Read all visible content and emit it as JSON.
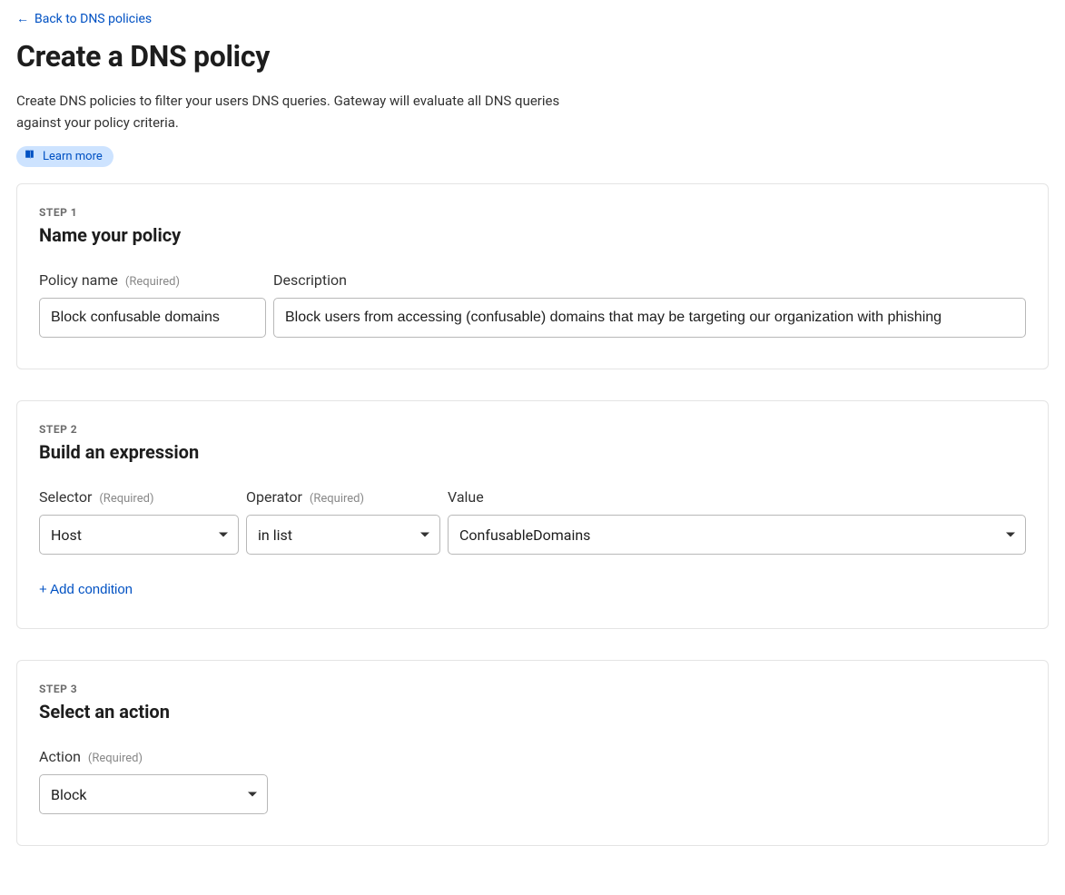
{
  "back_link": {
    "label": "Back to DNS policies"
  },
  "page": {
    "title": "Create a DNS policy",
    "description": "Create DNS policies to filter your users DNS queries. Gateway will evaluate all DNS queries against your policy criteria.",
    "learn_more_label": "Learn more"
  },
  "common": {
    "required_tag": "(Required)"
  },
  "step1": {
    "step_tag": "STEP 1",
    "title": "Name your policy",
    "policy_name": {
      "label": "Policy name",
      "value": "Block confusable domains"
    },
    "description": {
      "label": "Description",
      "value": "Block users from accessing (confusable) domains that may be targeting our organization with phishing"
    }
  },
  "step2": {
    "step_tag": "STEP 2",
    "title": "Build an expression",
    "selector": {
      "label": "Selector",
      "value": "Host"
    },
    "operator": {
      "label": "Operator",
      "value": "in list"
    },
    "value_field": {
      "label": "Value",
      "value": "ConfusableDomains"
    },
    "add_condition_label": "+ Add condition"
  },
  "step3": {
    "step_tag": "STEP 3",
    "title": "Select an action",
    "action": {
      "label": "Action",
      "value": "Block"
    }
  }
}
